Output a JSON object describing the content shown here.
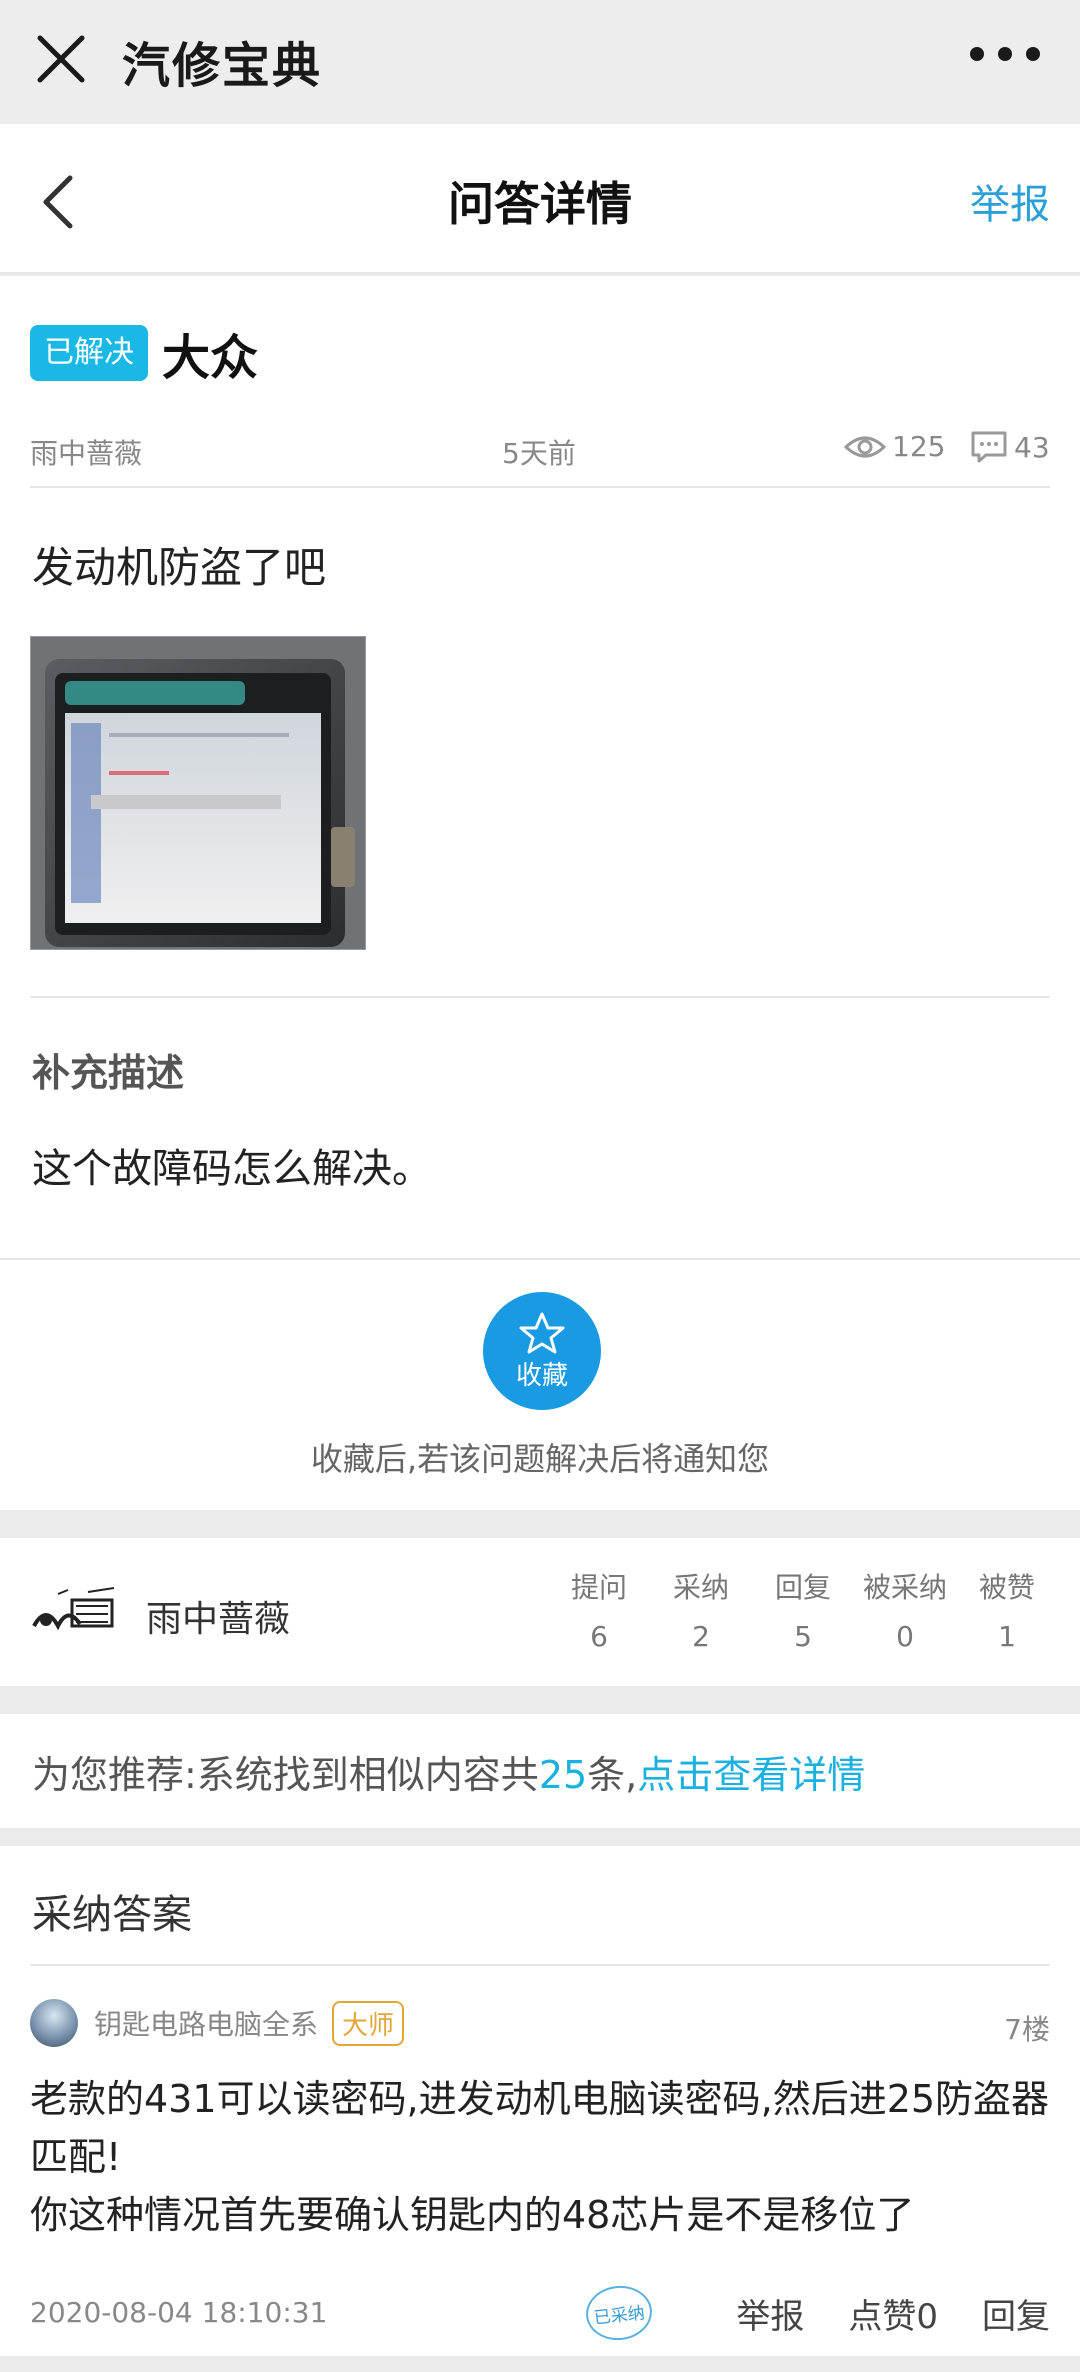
{
  "topbar": {
    "app_title": "汽修宝典"
  },
  "navbar": {
    "title": "问答详情",
    "report": "举报"
  },
  "question": {
    "status": "已解决",
    "title": "大众",
    "author": "雨中蔷薇",
    "time": "5天前",
    "views": "125",
    "comments": "43",
    "body": "发动机防盗了吧",
    "supplement_title": "补充描述",
    "supplement_body": "这个故障码怎么解决。",
    "favorite_label": "收藏",
    "favorite_tip": "收藏后,若该问题解决后将通知您"
  },
  "user": {
    "name": "雨中蔷薇",
    "stats": [
      {
        "label": "提问",
        "value": "6"
      },
      {
        "label": "采纳",
        "value": "2"
      },
      {
        "label": "回复",
        "value": "5"
      },
      {
        "label": "被采纳",
        "value": "0"
      },
      {
        "label": "被赞",
        "value": "1"
      }
    ]
  },
  "recommend": {
    "prefix": "为您推荐:系统找到相似内容共",
    "count": "25",
    "suffix": "条,",
    "link": "点击查看详情"
  },
  "answers": {
    "title": "采纳答案",
    "items": [
      {
        "author": "钥匙电路电脑全系",
        "level": "大师",
        "floor": "7楼",
        "body_line1": "老款的431可以读密码,进发动机电脑读密码,然后进25防盗器匹配!",
        "body_line2": "你这种情况首先要确认钥匙内的48芯片是不是移位了",
        "date": "2020-08-04 18:10:31",
        "stamp": "已采纳",
        "report": "举报",
        "like": "点赞0",
        "reply": "回复"
      }
    ]
  }
}
